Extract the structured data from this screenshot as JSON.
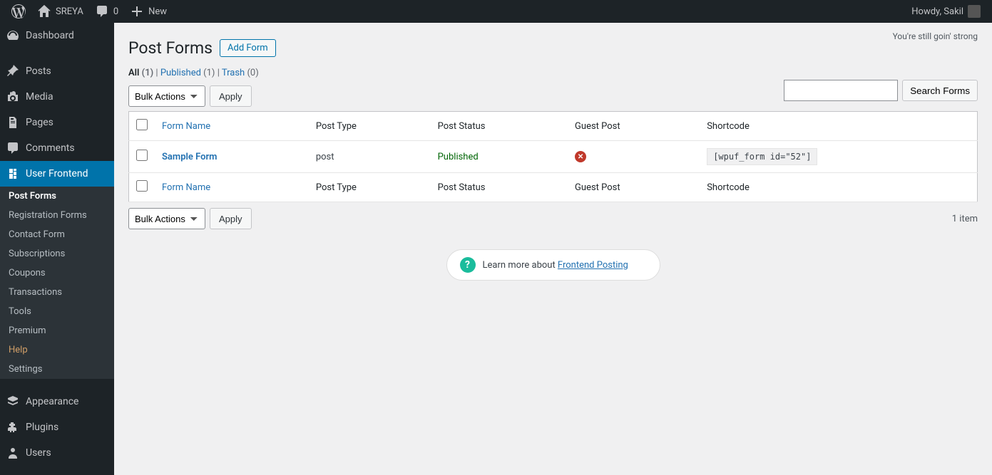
{
  "adminbar": {
    "site_name": "SREYA",
    "comments": "0",
    "new_label": "New",
    "howdy": "Howdy, Sakil"
  },
  "sidebar": {
    "items": [
      {
        "label": "Dashboard"
      },
      {
        "label": "Posts"
      },
      {
        "label": "Media"
      },
      {
        "label": "Pages"
      },
      {
        "label": "Comments"
      },
      {
        "label": "User Frontend"
      },
      {
        "label": "Appearance"
      },
      {
        "label": "Plugins"
      },
      {
        "label": "Users"
      }
    ],
    "submenu": [
      {
        "label": "Post Forms"
      },
      {
        "label": "Registration Forms"
      },
      {
        "label": "Contact Form"
      },
      {
        "label": "Subscriptions"
      },
      {
        "label": "Coupons"
      },
      {
        "label": "Transactions"
      },
      {
        "label": "Tools"
      },
      {
        "label": "Premium"
      },
      {
        "label": "Help"
      },
      {
        "label": "Settings"
      }
    ]
  },
  "page": {
    "notice": "You're still goin' strong",
    "title": "Post Forms",
    "add_button": "Add Form",
    "filters": {
      "all_label": "All",
      "all_count": "(1)",
      "pub_label": "Published",
      "pub_count": "(1)",
      "trash_label": "Trash",
      "trash_count": "(0)",
      "sep": " | "
    },
    "bulk_action": "Bulk Actions",
    "apply_label": "Apply",
    "item_count": "1 item",
    "search_btn": "Search Forms",
    "headers": {
      "form_name": "Form Name",
      "post_type": "Post Type",
      "post_status": "Post Status",
      "guest_post": "Guest Post",
      "shortcode": "Shortcode"
    },
    "rows": [
      {
        "form_name": "Sample Form",
        "post_type": "post",
        "post_status": "Published",
        "guest_post": false,
        "shortcode": "[wpuf_form id=\"52\"]"
      }
    ],
    "learn": {
      "prefix": "Learn more about ",
      "link": "Frontend Posting"
    }
  }
}
